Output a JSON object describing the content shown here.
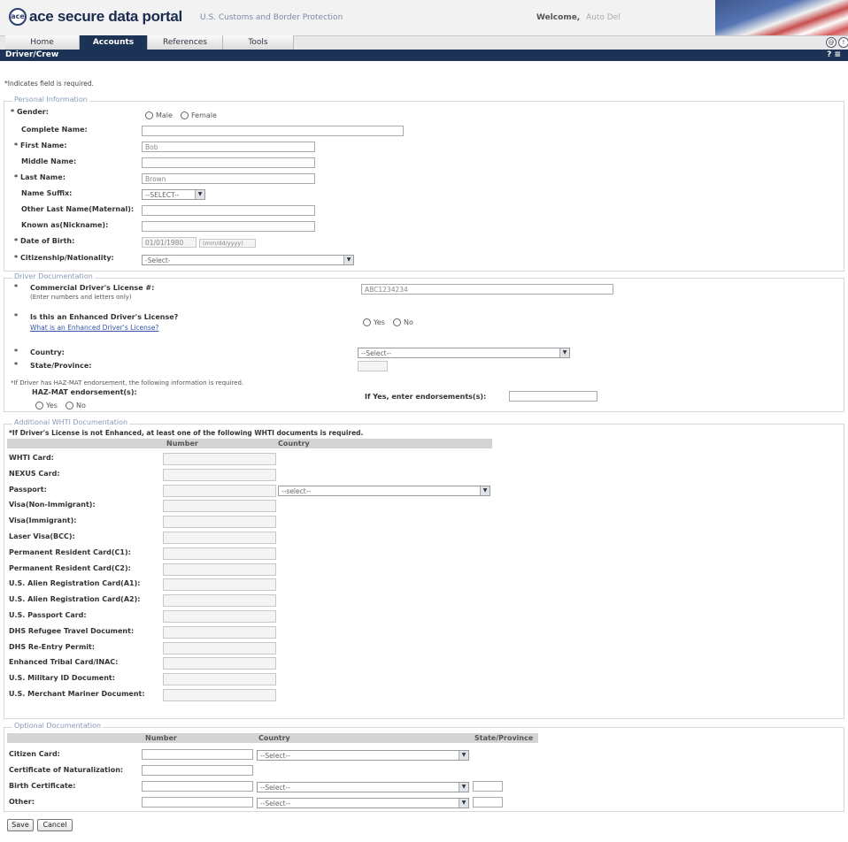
{
  "header": {
    "logo_letters": "ace",
    "app_title": "ace secure data portal",
    "app_subtitle": "U.S. Customs and Border Protection",
    "welcome": "Welcome,",
    "user_name": "Auto Del"
  },
  "nav": {
    "tabs": [
      {
        "label": "Home"
      },
      {
        "label": "Accounts"
      },
      {
        "label": "References"
      },
      {
        "label": "Tools"
      }
    ]
  },
  "page": {
    "title": "Driver/Crew",
    "icons": "? ≡",
    "required_note": "*Indicates field is required."
  },
  "personal": {
    "legend": "Personal Information",
    "gender_label": "* Gender:",
    "gender_male": "Male",
    "gender_female": "Female",
    "complete_name_label": "Complete Name:",
    "first_name_label": "* First Name:",
    "first_name_value": "Bob",
    "middle_name_label": "Middle Name:",
    "last_name_label": "* Last Name:",
    "last_name_value": "Brown",
    "name_suffix_label": "Name Suffix:",
    "name_suffix_value": "--SELECT--",
    "other_last_name_label": "Other Last Name(Maternal):",
    "known_as_label": "Known as(Nickname):",
    "dob_label": "* Date of Birth:",
    "dob_value": "01/01/1980",
    "dob_format": "(mm/dd/yyyy)",
    "citizenship_label": "* Citizenship/Nationality:",
    "citizenship_value": "-Select-"
  },
  "driver_doc": {
    "legend": "Driver Documentation",
    "cdl_label": "Commercial Driver's License #:",
    "cdl_hint": "(Enter numbers and letters only)",
    "cdl_value": "ABC1234234",
    "enhanced_label": "Is this an Enhanced Driver's License?",
    "enhanced_link": "What is an Enhanced Driver's License?",
    "yes": "Yes",
    "no": "No",
    "country_label": "Country:",
    "country_value": "--Select--",
    "state_label": "State/Province:",
    "hazmat_note": "*If Driver has HAZ-MAT endorsement, the following information is required.",
    "hazmat_label": "HAZ-MAT endorsement(s):",
    "hazmat_yes": "Yes",
    "hazmat_no": "No",
    "endorsements_label": "If Yes, enter endorsements(s):"
  },
  "whti": {
    "legend": "Additional WHTI Documentation",
    "note": "*If Driver's License is not Enhanced, at least one of the following WHTI documents is required.",
    "col_number": "Number",
    "col_country": "Country",
    "rows": [
      {
        "label": "WHTI Card:"
      },
      {
        "label": "NEXUS Card:"
      },
      {
        "label": "Passport:",
        "select": "--select--"
      },
      {
        "label": "Visa(Non-Immigrant):"
      },
      {
        "label": "Visa(Immigrant):"
      },
      {
        "label": "Laser Visa(BCC):"
      },
      {
        "label": "Permanent Resident Card(C1):"
      },
      {
        "label": "Permanent Resident Card(C2):"
      },
      {
        "label": "U.S. Alien Registration Card(A1):"
      },
      {
        "label": "U.S. Alien Registration Card(A2):"
      },
      {
        "label": "U.S. Passport Card:"
      },
      {
        "label": "DHS Refugee Travel Document:"
      },
      {
        "label": "DHS Re-Entry Permit:"
      },
      {
        "label": "Enhanced Tribal Card/INAC:"
      },
      {
        "label": "U.S. Military ID Document:"
      },
      {
        "label": "U.S. Merchant Mariner Document:"
      }
    ]
  },
  "optional": {
    "legend": "Optional Documentation",
    "col_number": "Number",
    "col_country": "Country",
    "col_state": "State/Province",
    "rows": [
      {
        "label": "Citizen Card:",
        "select": "--Select--"
      },
      {
        "label": "Certificate of Naturalization:"
      },
      {
        "label": "Birth Certificate:",
        "select": "--Select--"
      },
      {
        "label": "Other:",
        "select": "--Select--"
      }
    ]
  },
  "buttons": {
    "save": "Save",
    "cancel": "Cancel"
  }
}
